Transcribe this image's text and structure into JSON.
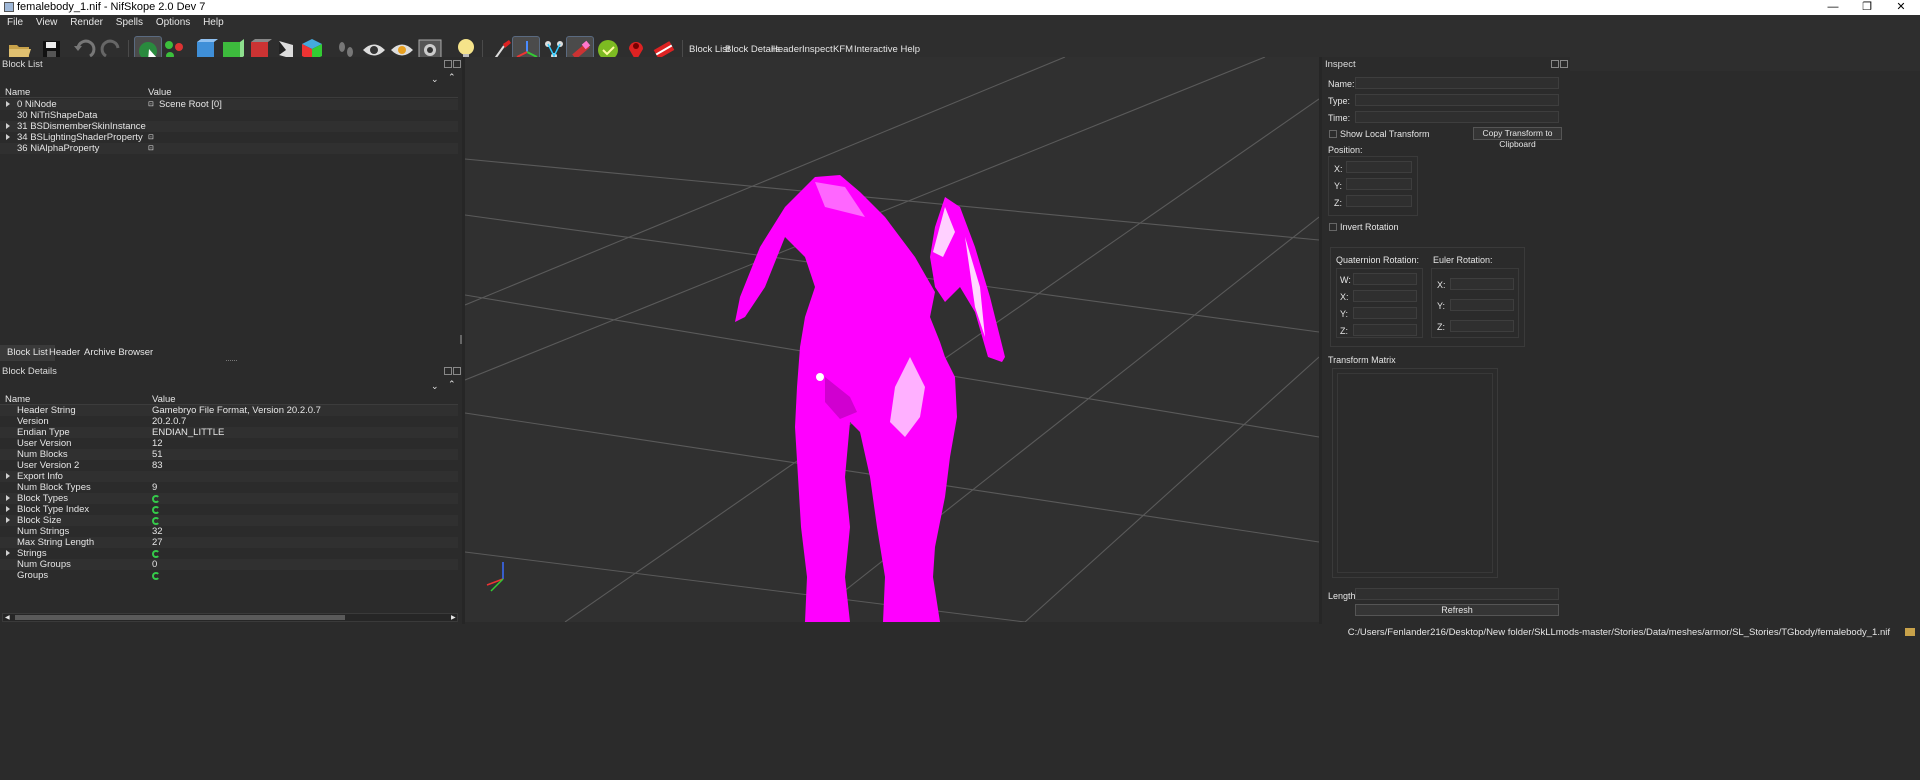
{
  "window": {
    "title": "femalebody_1.nif - NifSkope 2.0 Dev 7",
    "minimize": "—",
    "maximize": "❐",
    "close": "✕"
  },
  "menu": [
    "File",
    "View",
    "Render",
    "Spells",
    "Options",
    "Help"
  ],
  "toolbar": {
    "icons": [
      "open-folder-icon",
      "save-icon",
      "undo-icon",
      "redo-icon",
      "select-object-icon",
      "select-vertex-icon",
      "view-front-icon",
      "view-side-icon",
      "view-back-icon",
      "view-top-icon",
      "view-walk-icon",
      "footprint-icon",
      "eye-icon",
      "eye-hidden-icon",
      "camera-icon",
      "light-bulb-icon",
      "brush-icon",
      "axes-icon",
      "node-tree-icon",
      "wireframe-icon",
      "normals-icon",
      "marker-icon",
      "eraser-icon"
    ],
    "text_buttons": [
      "Block List",
      "Block Details",
      "Header",
      "Inspect",
      "KFM",
      "Interactive Help"
    ]
  },
  "block_list": {
    "title": "Block List",
    "col_name": "Name",
    "col_value": "Value",
    "rows": [
      {
        "name": "0 NiNode",
        "value": "Scene Root [0]",
        "expandable": true,
        "icon": true
      },
      {
        "name": "30 NiTriShapeData",
        "value": "",
        "expandable": false,
        "icon": false
      },
      {
        "name": "31 BSDismemberSkinInstance",
        "value": "",
        "expandable": true,
        "icon": false
      },
      {
        "name": "34 BSLightingShaderProperty",
        "value": "",
        "expandable": true,
        "icon": true
      },
      {
        "name": "36 NiAlphaProperty",
        "value": "",
        "expandable": false,
        "icon": true
      }
    ],
    "tabs": [
      "Block List",
      "Header",
      "Archive Browser"
    ]
  },
  "block_details": {
    "title": "Block Details",
    "col_name": "Name",
    "col_value": "Value",
    "rows": [
      {
        "name": "Header String",
        "value": "Gamebryo File Format, Version 20.2.0.7",
        "expandable": false
      },
      {
        "name": "Version",
        "value": "20.2.0.7",
        "expandable": false
      },
      {
        "name": "Endian Type",
        "value": "ENDIAN_LITTLE",
        "expandable": false
      },
      {
        "name": "User Version",
        "value": "12",
        "expandable": false
      },
      {
        "name": "Num Blocks",
        "value": "51",
        "expandable": false
      },
      {
        "name": "User Version 2",
        "value": "83",
        "expandable": false
      },
      {
        "name": "Export Info",
        "value": "",
        "expandable": true
      },
      {
        "name": "Num Block Types",
        "value": "9",
        "expandable": false
      },
      {
        "name": "Block Types",
        "value": "",
        "expandable": true,
        "refresh": true
      },
      {
        "name": "Block Type Index",
        "value": "",
        "expandable": true,
        "refresh": true
      },
      {
        "name": "Block Size",
        "value": "",
        "expandable": true,
        "refresh": true
      },
      {
        "name": "Num Strings",
        "value": "32",
        "expandable": false
      },
      {
        "name": "Max String Length",
        "value": "27",
        "expandable": false
      },
      {
        "name": "Strings",
        "value": "",
        "expandable": true,
        "refresh": true
      },
      {
        "name": "Num Groups",
        "value": "0",
        "expandable": false
      },
      {
        "name": "Groups",
        "value": "",
        "expandable": false,
        "refresh": true
      }
    ]
  },
  "inspect": {
    "title": "Inspect",
    "name_label": "Name:",
    "type_label": "Type:",
    "time_label": "Time:",
    "show_local": "Show Local Transform",
    "copy_btn": "Copy Transform to Clipboard",
    "position": "Position:",
    "x": "X:",
    "y": "Y:",
    "z": "Z:",
    "w": "W:",
    "invert": "Invert Rotation",
    "quat": "Quaternion Rotation:",
    "euler": "Euler Rotation:",
    "matrix": "Transform Matrix",
    "length": "Length:",
    "refresh": "Refresh"
  },
  "status": {
    "path": "C:/Users/Fenlander216/Desktop/New folder/SkLLmods-master/Stories/Data/meshes/armor/SL_Stories/TGbody/femalebody_1.nif"
  },
  "colors": {
    "mesh": "#ff00ff",
    "bg": "#2b2b2b",
    "viewport": "#303030"
  }
}
